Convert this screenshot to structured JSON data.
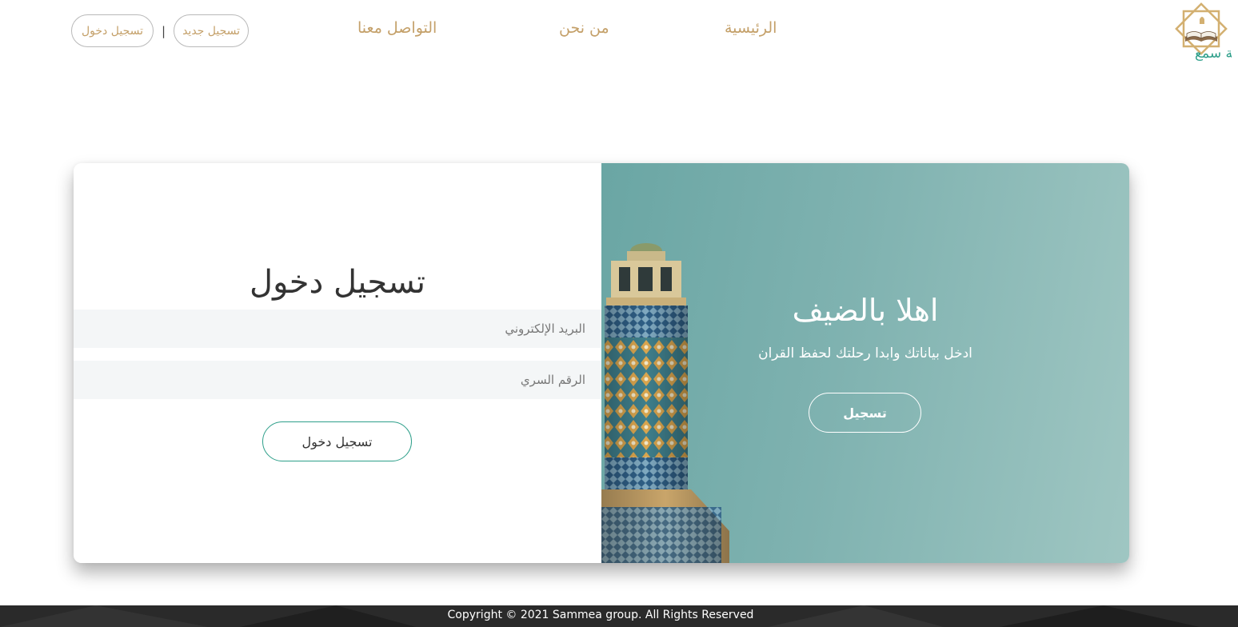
{
  "header": {
    "auth": {
      "login_label": "تسجيل دخول",
      "separator": "|",
      "register_label": "تسجيل جديد"
    },
    "nav": {
      "home": "الرئيسية",
      "about": "من نحن",
      "contact": "التواصل معنا"
    },
    "logo": {
      "text": "منصة سمع"
    }
  },
  "login_form": {
    "title": "تسجيل دخول",
    "email_placeholder": "البريد الإلكتروني",
    "password_placeholder": "الرقم السري",
    "submit_label": "تسجيل دخول"
  },
  "welcome_panel": {
    "title": "اهلا بالضيف",
    "subtitle": "ادخل بياناتك وابدا رحلتك لحفظ القران",
    "register_button": "تسجيل"
  },
  "footer": {
    "copyright": "Copyright © 2021 Sammea group. All Rights Reserved"
  },
  "colors": {
    "accent_gold": "#c4a069",
    "accent_teal": "#2e9f8a",
    "hero_teal": "#7fb2b0",
    "footer_bg": "#2a2a2a"
  }
}
